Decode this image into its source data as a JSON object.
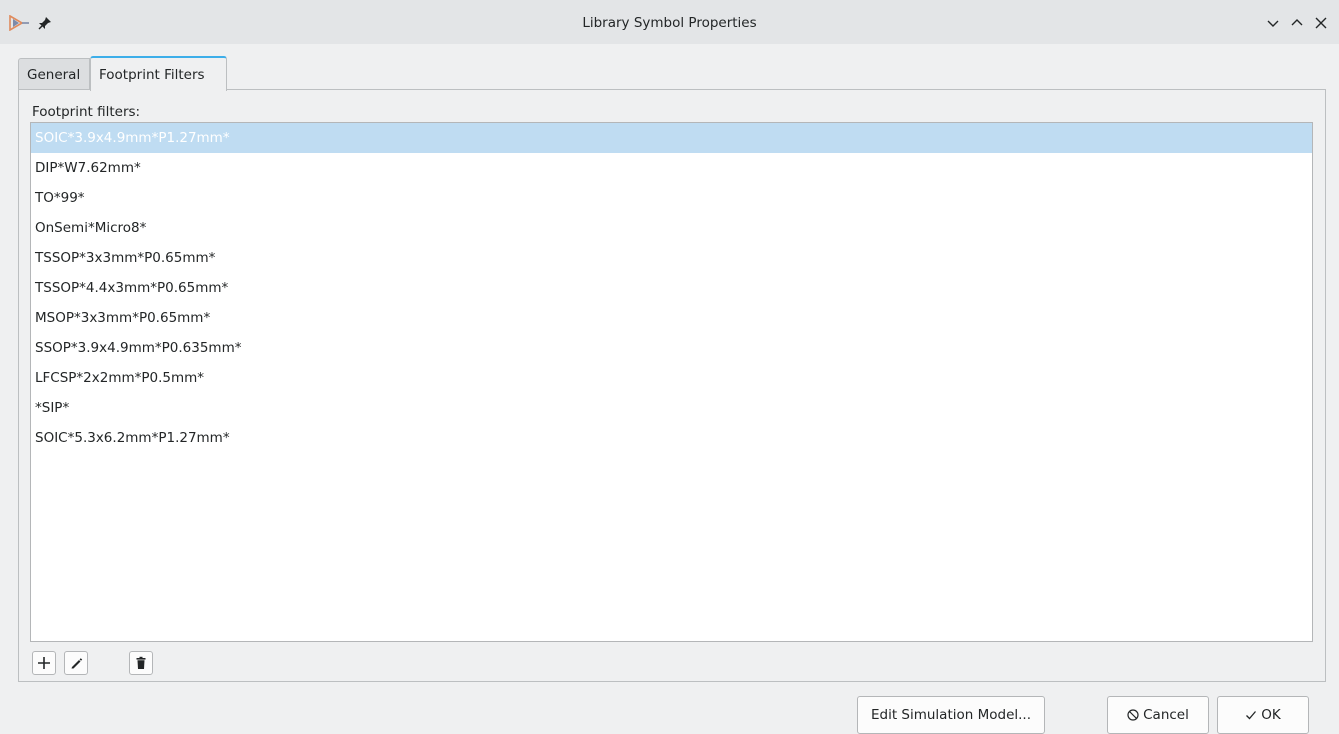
{
  "window": {
    "title": "Library Symbol Properties",
    "app_icon": "kicad-symbol-icon",
    "pin_icon": "pin-icon",
    "controls": [
      "minimize-icon",
      "maximize-icon",
      "close-icon"
    ]
  },
  "tabs": [
    {
      "label": "General",
      "active": false
    },
    {
      "label": "Footprint Filters",
      "active": true
    }
  ],
  "footprint_filters": {
    "label": "Footprint filters:",
    "items": [
      "SOIC*3.9x4.9mm*P1.27mm*",
      "DIP*W7.62mm*",
      "TO*99*",
      "OnSemi*Micro8*",
      "TSSOP*3x3mm*P0.65mm*",
      "TSSOP*4.4x3mm*P0.65mm*",
      "MSOP*3x3mm*P0.65mm*",
      "SSOP*3.9x4.9mm*P0.635mm*",
      "LFCSP*2x2mm*P0.5mm*",
      "*SIP*",
      "SOIC*5.3x6.2mm*P1.27mm*"
    ],
    "selected_index": 0
  },
  "list_buttons": [
    "add-icon",
    "edit-icon",
    "delete-icon"
  ],
  "footer": {
    "edit_sim_label": "Edit Simulation Model...",
    "cancel_label": "Cancel",
    "ok_label": "OK"
  },
  "colors": {
    "accent": "#3daee9",
    "selection": "#bfdcf2"
  }
}
